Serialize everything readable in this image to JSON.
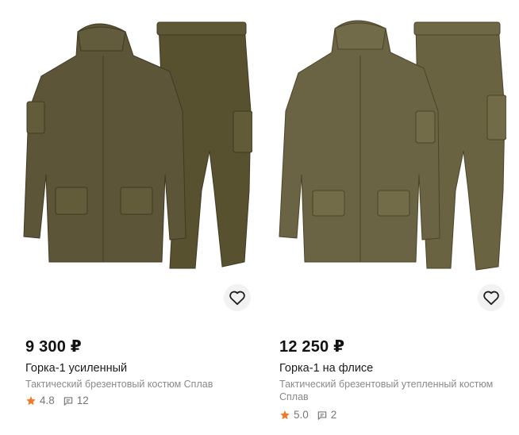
{
  "products": [
    {
      "price": "9 300 ₽",
      "title": "Горка-1 усиленный",
      "subtitle": "Тактический брезентовый костюм Сплав",
      "rating": "4.8",
      "reviews": "12",
      "icons": {
        "favorite": "heart-outline-icon",
        "rating": "star-icon",
        "reviews": "comment-icon"
      }
    },
    {
      "price": "12 250 ₽",
      "title": "Горка-1 на флисе",
      "subtitle": "Тактический брезентовый утепленный костюм Сплав",
      "rating": "5.0",
      "reviews": "2",
      "icons": {
        "favorite": "heart-outline-icon",
        "rating": "star-icon",
        "reviews": "comment-icon"
      }
    }
  ],
  "colors": {
    "star": "#f07a28",
    "product_jacket_1": "#5c5538",
    "product_jacket_2": "#6b6444",
    "price_text": "#111111",
    "muted_text": "#8a8a8a"
  }
}
